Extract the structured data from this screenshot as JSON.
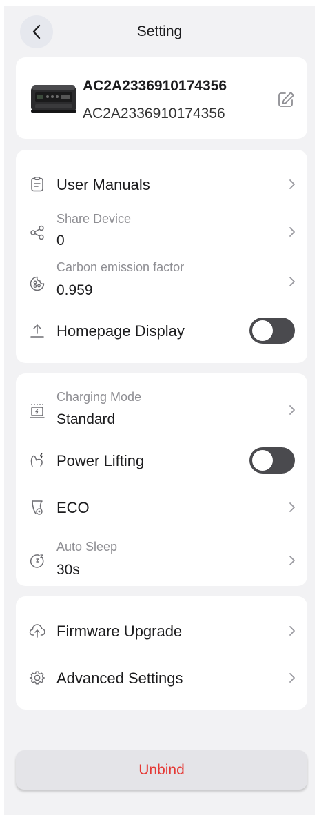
{
  "header": {
    "title": "Setting"
  },
  "device": {
    "name": "AC2A2336910174356",
    "serial": "AC2A2336910174356"
  },
  "general": {
    "user_manuals": {
      "label": "User Manuals"
    },
    "share_device": {
      "label": "Share Device",
      "value": "0"
    },
    "carbon": {
      "label": "Carbon emission factor",
      "value": "0.959"
    },
    "homepage_display": {
      "label": "Homepage Display",
      "enabled": false
    }
  },
  "power": {
    "charging_mode": {
      "label": "Charging Mode",
      "value": "Standard"
    },
    "power_lifting": {
      "label": "Power Lifting",
      "enabled": false
    },
    "eco": {
      "label": "ECO"
    },
    "auto_sleep": {
      "label": "Auto Sleep",
      "value": "30s"
    }
  },
  "system": {
    "firmware": {
      "label": "Firmware Upgrade"
    },
    "advanced": {
      "label": "Advanced Settings"
    }
  },
  "unbind": {
    "label": "Unbind"
  },
  "colors": {
    "danger": "#e53935",
    "toggle_off": "#4a4a4e",
    "background": "#f2f2f4"
  }
}
